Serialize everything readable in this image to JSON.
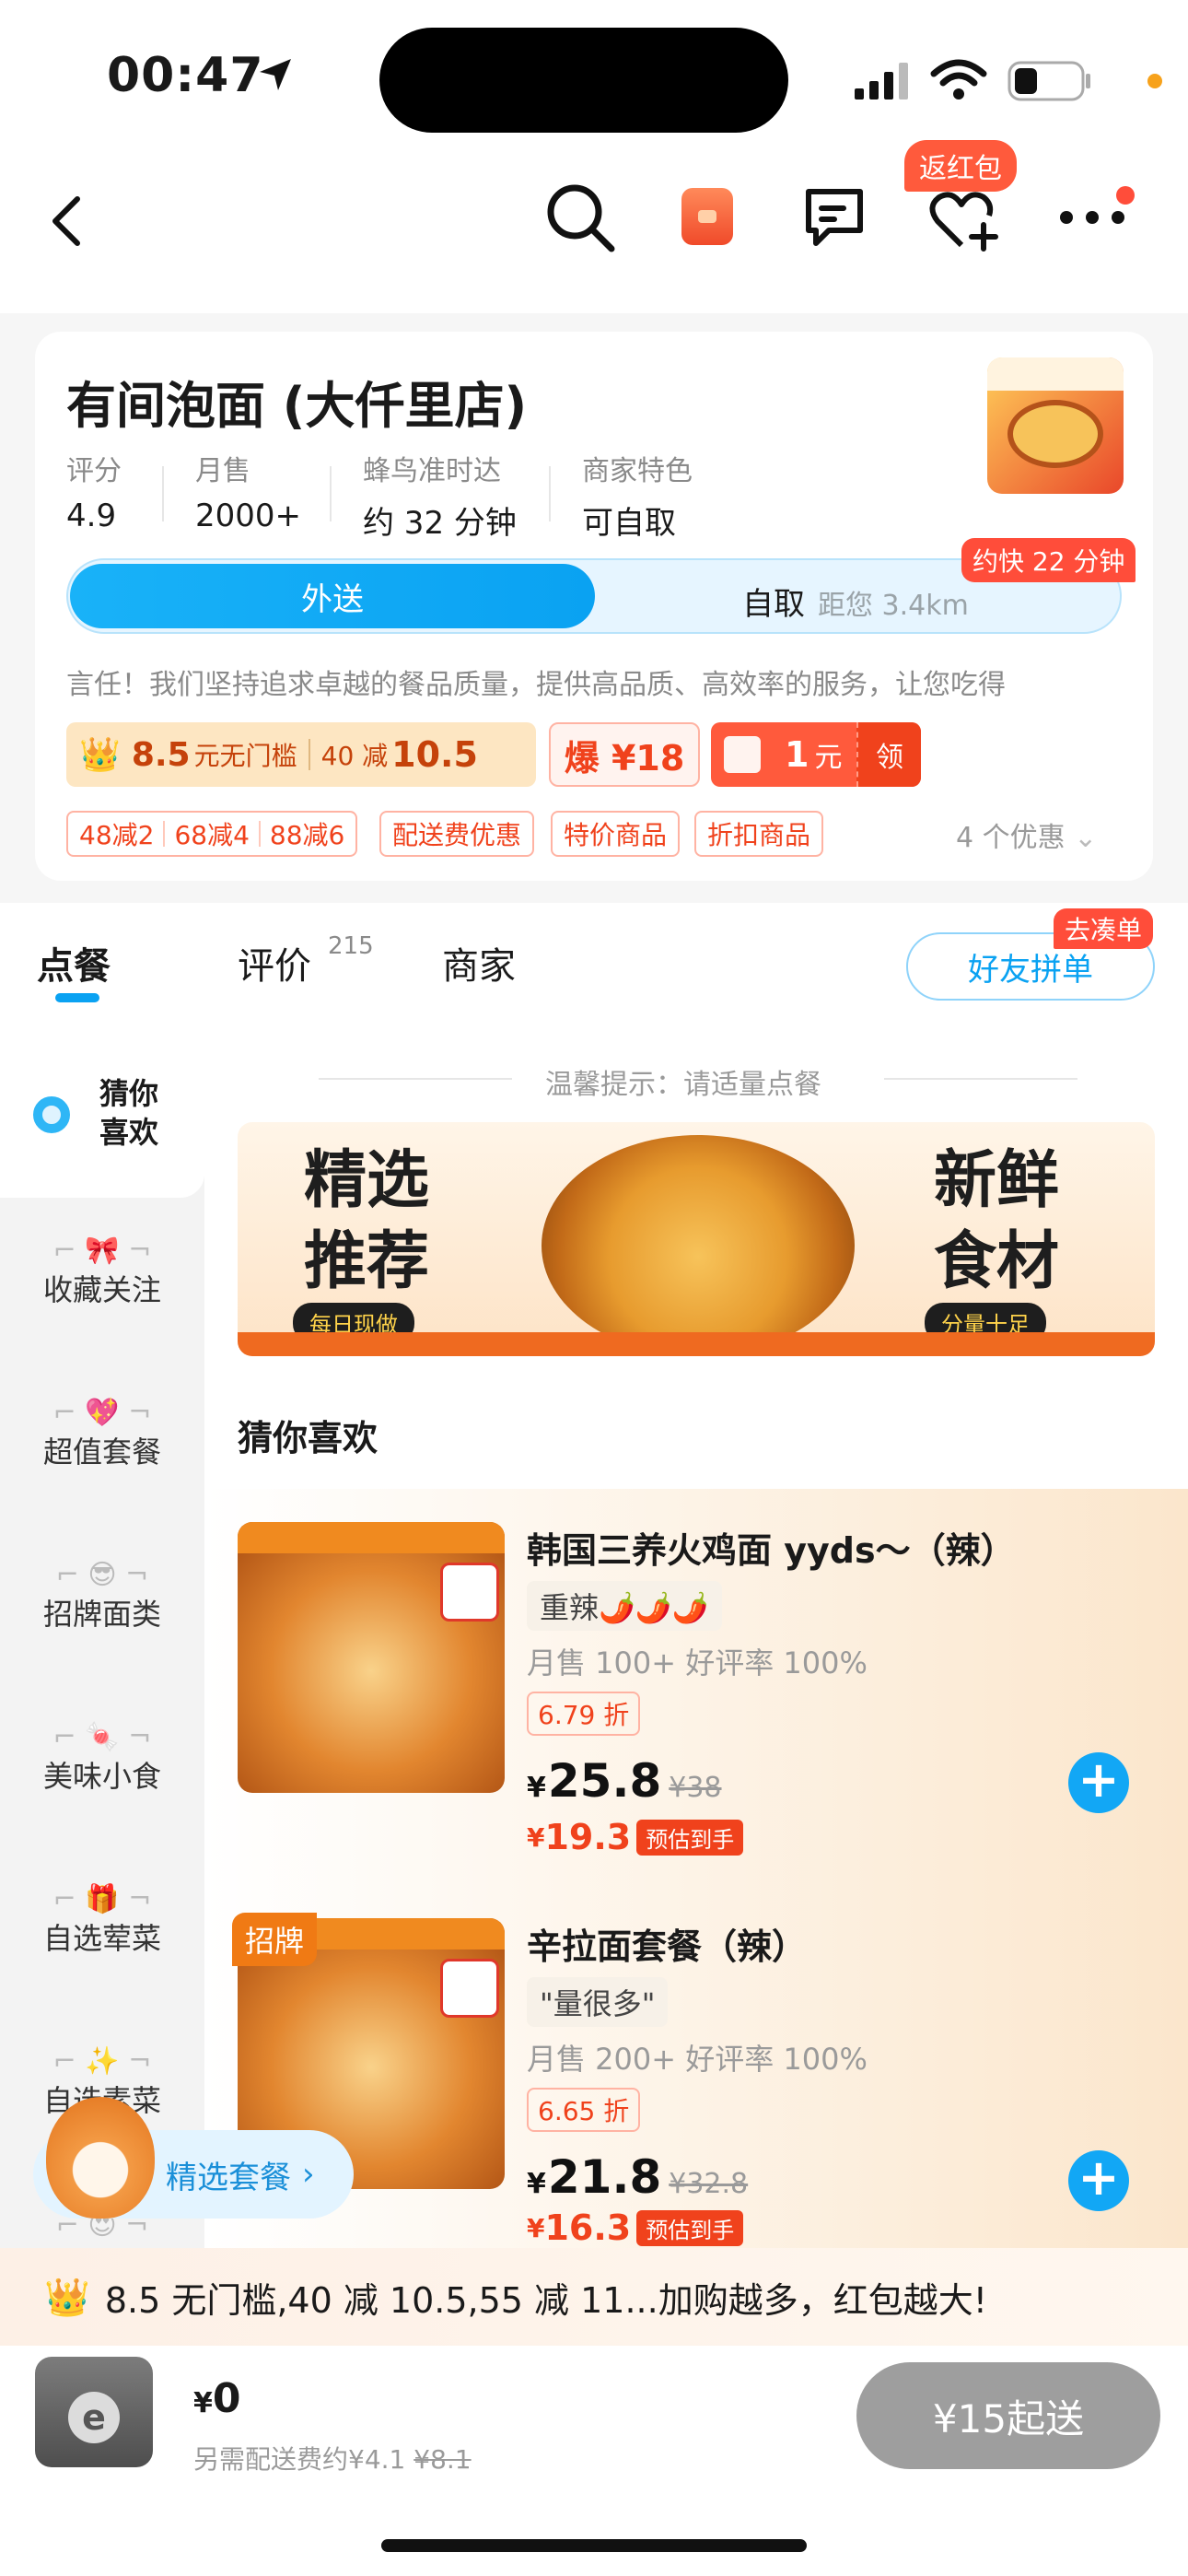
{
  "status_bar": {
    "time": "00:47"
  },
  "nav": {
    "hongbao_tag": "返红包"
  },
  "shop": {
    "name": "有间泡面 (大仟里店)",
    "stats": [
      {
        "label": "评分",
        "value": "4.9"
      },
      {
        "label": "月售",
        "value": "2000+"
      },
      {
        "label": "蜂鸟准时达",
        "value": "约 32 分钟"
      },
      {
        "label": "商家特色",
        "value": "可自取"
      }
    ],
    "delivery_tab": "外送",
    "pickup_tab": "自取",
    "pickup_distance": "距您 3.4km",
    "faster_tag": "约快 22 分钟",
    "slogan": "言任！我们坚持追求卓越的餐品质量，提供高品质、高效率的服务，让您吃得",
    "coupon_member": {
      "amount": "8.5",
      "desc": "元无门槛",
      "threshold": "40 减",
      "off": "10.5"
    },
    "coupon_hot": "爆 ¥18",
    "coupon_cash": {
      "amount": "1",
      "unit": "元",
      "action": "领"
    },
    "tags": [
      "48减2",
      "68减4",
      "88减6",
      "配送费优惠",
      "特价商品",
      "折扣商品"
    ],
    "promo_count": "4 个优惠"
  },
  "tabs": {
    "order": "点餐",
    "reviews": "评价",
    "reviews_count": "215",
    "merchant": "商家",
    "friend_order": "好友拼单",
    "go_tag": "去凑单"
  },
  "sidebar": {
    "active": "猜你喜欢",
    "items": [
      "收藏关注",
      "超值套餐",
      "招牌面类",
      "美味小食",
      "自选荤菜",
      "自选素菜"
    ]
  },
  "content": {
    "tip": "温馨提示：请适量点餐",
    "banner": {
      "left": "精选\n推荐",
      "left_badge": "每日现做",
      "right": "新鲜\n食材",
      "right_badge": "分量十足"
    },
    "section_title": "猜你喜欢"
  },
  "products": [
    {
      "name": "韩国三养火鸡面 yyds～（辣）",
      "note": "重辣🌶️🌶️🌶️",
      "sales": "月售 100+ 好评率 100%",
      "discount": "6.79 折",
      "price": "25.8",
      "old_price": "¥38",
      "est_price": "19.3",
      "est_label": "预估到手"
    },
    {
      "badge": "招牌",
      "name": "辛拉面套餐（辣）",
      "note": "\"量很多\"",
      "sales": "月售 200+ 好评率 100%",
      "discount": "6.65 折",
      "price": "21.8",
      "old_price": "¥32.8",
      "est_price": "16.3",
      "est_label": "预估到手"
    }
  ],
  "floating_pill": "精选套餐",
  "promo_bar": "8.5 无门槛,40 减 10.5,55 减 11...加购越多，红包越大!",
  "cart": {
    "total": "0",
    "sub_label": "另需配送费约¥4.1",
    "sub_old": "¥8.1",
    "start_button": "¥15起送"
  },
  "colors": {
    "accent": "#0aa2f2",
    "promo": "#f0421c"
  }
}
